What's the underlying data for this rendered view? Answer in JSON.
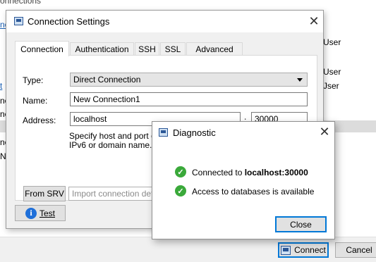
{
  "background": {
    "title_fragment": "onnections",
    "left_fragments": [
      "no",
      "t",
      "ne",
      "ne",
      "ne",
      "ne",
      "Ne"
    ],
    "right_items": [
      "User",
      "User",
      "Jser"
    ],
    "footer": {
      "connect_label": "Connect",
      "cancel_label": "Cancel"
    }
  },
  "dialog": {
    "title": "Connection Settings",
    "close_glyph": "✕",
    "tabs": [
      "Connection",
      "Authentication",
      "SSH",
      "SSL",
      "Advanced"
    ],
    "active_tab": "Connection",
    "type_label": "Type:",
    "type_value": "Direct Connection",
    "name_label": "Name:",
    "name_value": "New Connection1",
    "address_label": "Address:",
    "address_value": "localhost",
    "port_separator": ":",
    "port_value": "30000",
    "hint_line1": "Specify host and port of",
    "hint_line2": "IPv6 or domain name.",
    "from_srv_label": "From SRV",
    "import_placeholder": "Import connection details",
    "test_label": "Test",
    "test_icon_glyph": "i"
  },
  "diagnostic": {
    "title": "Diagnostic",
    "close_glyph": "✕",
    "msg1_prefix": "Connected to ",
    "msg1_host": "localhost:30000",
    "msg2": "Access to databases is available",
    "check_glyph": "✓",
    "close_button_label": "Close"
  },
  "colors": {
    "accent": "#0078d7",
    "success": "#3aa93a",
    "info": "#1e6fd9"
  }
}
